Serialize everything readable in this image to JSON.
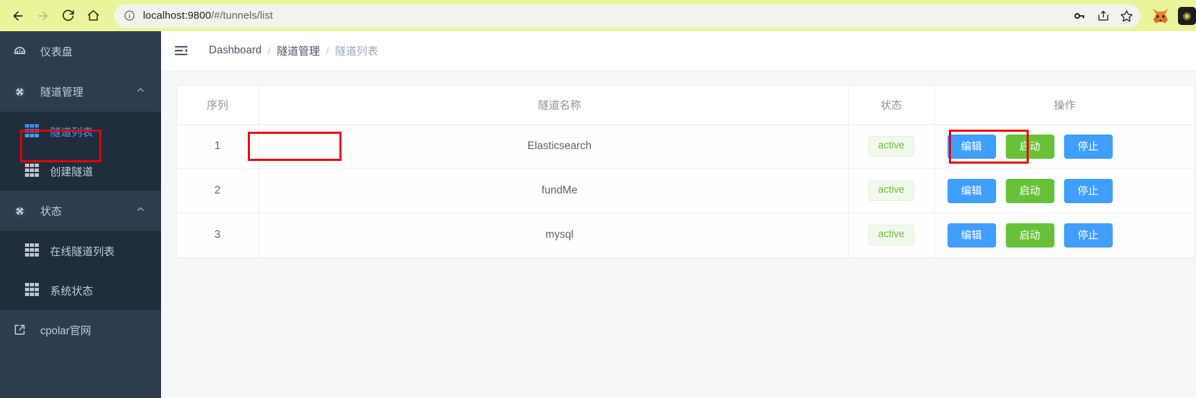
{
  "browser": {
    "back_label": "back-arrow",
    "forward_label": "forward-arrow",
    "reload_label": "reload",
    "home_label": "home",
    "url_host": "localhost:9800",
    "url_path": "/#/tunnels/list",
    "url_full": "localhost:9800/#/tunnels/list",
    "toolbar_bg": "#eaf49a",
    "icons": {
      "info": "site-info-icon",
      "password": "key-icon",
      "share": "share-icon",
      "bookmark": "star-icon",
      "metamask": "fox-icon",
      "extension": "extension-icon"
    }
  },
  "sidebar": {
    "bg": "#2e3c4e",
    "submenu_bg": "#1f2d3d",
    "active_color": "#409eff",
    "items": [
      {
        "label": "仪表盘",
        "icon": "dashboard-gauge-icon",
        "expandable": false
      },
      {
        "label": "隧道管理",
        "icon": "compass-icon",
        "expandable": true,
        "expanded": true
      },
      {
        "label": "状态",
        "icon": "compass-icon",
        "expandable": true,
        "expanded": true
      }
    ],
    "tunnel_submenu": [
      {
        "label": "隧道列表",
        "icon": "grid-icon",
        "active": true
      },
      {
        "label": "创建隧道",
        "icon": "grid-icon",
        "active": false
      }
    ],
    "status_submenu": [
      {
        "label": "在线隧道列表",
        "icon": "grid-icon",
        "active": false
      },
      {
        "label": "系统状态",
        "icon": "grid-icon",
        "active": false
      }
    ],
    "external": {
      "label": "cpolar官网",
      "icon": "external-link-icon"
    }
  },
  "topbar": {
    "collapse_icon": "collapse-menu-icon",
    "breadcrumb": [
      {
        "label": "Dashboard",
        "current": false
      },
      {
        "label": "隧道管理",
        "current": false
      },
      {
        "label": "隧道列表",
        "current": true
      }
    ],
    "separator": "/"
  },
  "table": {
    "headers": {
      "seq": "序列",
      "name": "隧道名称",
      "status": "状态",
      "ops": "操作"
    },
    "rows": [
      {
        "seq": "1",
        "name": "Elasticsearch",
        "status": "active"
      },
      {
        "seq": "2",
        "name": "fundMe",
        "status": "active"
      },
      {
        "seq": "3",
        "name": "mysql",
        "status": "active"
      }
    ],
    "buttons": {
      "edit": "编辑",
      "start": "启动",
      "stop": "停止"
    },
    "colors": {
      "primary": "#409eff",
      "success": "#67c23a",
      "tag_bg": "#f0f9eb",
      "tag_text": "#67c23a",
      "border": "#ebeef5"
    }
  },
  "annotations": {
    "color": "#e60000",
    "boxes": [
      {
        "target": "sidebar-item-tunnel-list"
      },
      {
        "target": "tunnel-name-cell-row1"
      },
      {
        "target": "edit-button-row1"
      }
    ]
  }
}
